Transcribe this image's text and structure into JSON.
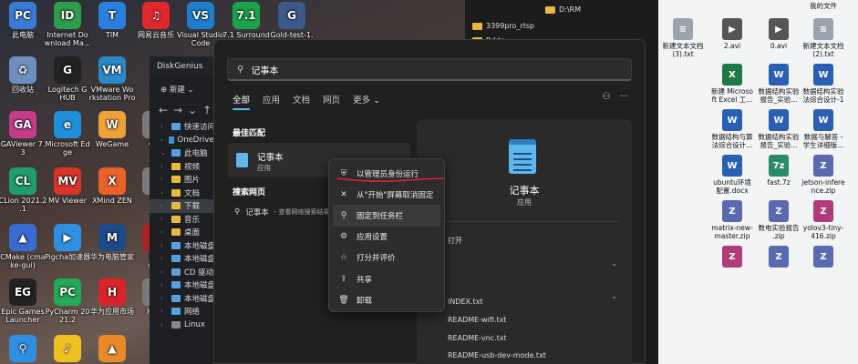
{
  "desktop_left": [
    {
      "label": "此电脑",
      "color": "#3a7bd5",
      "glyph": "PC"
    },
    {
      "label": "Internet Do\nwnload Ma...",
      "color": "#2e9d4a",
      "glyph": "ID"
    },
    {
      "label": "TIM",
      "color": "#2b7fe0",
      "glyph": "T"
    },
    {
      "label": "网易云音乐",
      "color": "#e0282e",
      "glyph": "♫"
    },
    {
      "label": "Visual Studio\nCode",
      "color": "#1f7fcf",
      "glyph": "VS"
    },
    {
      "label": "7.1 Surround",
      "color": "#1aa34a",
      "glyph": "7.1"
    },
    {
      "label": "Gold-test-1.",
      "color": "#3b5a8a",
      "glyph": "G"
    },
    {
      "label": "回收站",
      "color": "#6d8fbf",
      "glyph": "♻"
    },
    {
      "label": "Logitech G\nHUB",
      "color": "#222222",
      "glyph": "G"
    },
    {
      "label": "VMware Wo\nrkstation Pro",
      "color": "#2a8ac8",
      "glyph": "VM"
    },
    {
      "label": "GAViewer 7.\n3",
      "color": "#c43c8a",
      "glyph": "GA"
    },
    {
      "label": "Microsoft Ed\nge",
      "color": "#1e8fd8",
      "glyph": "e"
    },
    {
      "label": "WeGame",
      "color": "#f0a23a",
      "glyph": "W"
    },
    {
      "label": "Ope",
      "color": "#7a7a7a",
      "glyph": "O"
    },
    {
      "label": "CLion 2021.2\n.1",
      "color": "#1f9d6a",
      "glyph": "CL"
    },
    {
      "label": "MV Viewer",
      "color": "#d8342a",
      "glyph": "MV"
    },
    {
      "label": "XMind ZEN",
      "color": "#e8622a",
      "glyph": "X"
    },
    {
      "label": "Pic",
      "color": "#7a7a7a",
      "glyph": "P"
    },
    {
      "label": "CMake (cma\nke-gui)",
      "color": "#3a6bd0",
      "glyph": "▲"
    },
    {
      "label": "Pigcha加速器",
      "color": "#2f8fe0",
      "glyph": "▶"
    },
    {
      "label": "华为电脑管家",
      "color": "#1f4a8a",
      "glyph": "M"
    },
    {
      "label": "Red\ndem",
      "color": "#aa2222",
      "glyph": "R"
    },
    {
      "label": "Epic Games\nLauncher",
      "color": "#222222",
      "glyph": "EG"
    },
    {
      "label": "PyCharm 20\n21.2",
      "color": "#22aa55",
      "glyph": "PC"
    },
    {
      "label": "华为应用市场",
      "color": "#d8242a",
      "glyph": "H"
    },
    {
      "label": "HBUI",
      "color": "#7a7a7a",
      "glyph": "H"
    },
    {
      "label": "",
      "color": "#2f8fe0",
      "glyph": "⚲"
    },
    {
      "label": "",
      "color": "#f0c020",
      "glyph": "♪"
    },
    {
      "label": "",
      "color": "#e88a2a",
      "glyph": "▲"
    }
  ],
  "desktop_right": [
    {
      "label": "我的文件",
      "color": "#e8b93c",
      "glyph": ""
    },
    {
      "label": "新建文本文档\n(3).txt",
      "color": "#9aa4b0",
      "glyph": "≡"
    },
    {
      "label": "2.avi",
      "color": "#555555",
      "glyph": "▶"
    },
    {
      "label": "0.avi",
      "color": "#555555",
      "glyph": "▶"
    },
    {
      "label": "新建文本文档\n(2).txt",
      "color": "#9aa4b0",
      "glyph": "≡"
    },
    {
      "label": "新建 Microso\nft Excel 工...",
      "color": "#1d7a43",
      "glyph": "X"
    },
    {
      "label": "数据结构实验\n报告_实验...",
      "color": "#2b5fb3",
      "glyph": "W"
    },
    {
      "label": "数据结构实验\n法综合设计-1",
      "color": "#2b5fb3",
      "glyph": "W"
    },
    {
      "label": "数据结构与算\n法综合设计...",
      "color": "#2b5fb3",
      "glyph": "W"
    },
    {
      "label": "数据结构实验\n报告_实验...",
      "color": "#2b5fb3",
      "glyph": "W"
    },
    {
      "label": "数据与解答 -\n学生详细版...",
      "color": "#2b5fb3",
      "glyph": "W"
    },
    {
      "label": "ubuntu环境\n配置.docx",
      "color": "#2b5fb3",
      "glyph": "W"
    },
    {
      "label": "fast.7z",
      "color": "#2a8a6a",
      "glyph": "7z"
    },
    {
      "label": "jetson-infere\nnce.zip",
      "color": "#5a6ab0",
      "glyph": "Z"
    },
    {
      "label": "matrix-new-\nmaster.zip",
      "color": "#5a6ab0",
      "glyph": "Z"
    },
    {
      "label": "数电实验报告\n.zip",
      "color": "#5a6ab0",
      "glyph": "Z"
    },
    {
      "label": "yolov3-tiny-\n416.zip",
      "color": "#b03a7a",
      "glyph": "Z"
    },
    {
      "label": "",
      "color": "#b03a7a",
      "glyph": "Z"
    },
    {
      "label": "",
      "color": "#5a6ab0",
      "glyph": "Z"
    },
    {
      "label": "",
      "color": "#5a6ab0",
      "glyph": "Z"
    }
  ],
  "diskgenius": {
    "title": "DiskGenius",
    "new_label": "新建",
    "tree": [
      {
        "label": "快速访问",
        "chev": "›",
        "icon": "star"
      },
      {
        "label": "OneDrive - Pe",
        "chev": "›",
        "icon": "cloud"
      },
      {
        "label": "此电脑",
        "chev": "⌄",
        "icon": "pc"
      },
      {
        "label": "视频",
        "chev": "›",
        "icon": "folder"
      },
      {
        "label": "图片",
        "chev": "›",
        "icon": "folder"
      },
      {
        "label": "文档",
        "chev": "›",
        "icon": "folder"
      },
      {
        "label": "下载",
        "chev": "›",
        "icon": "folder"
      },
      {
        "label": "音乐",
        "chev": "›",
        "icon": "folder"
      },
      {
        "label": "桌面",
        "chev": "›",
        "icon": "folder"
      },
      {
        "label": "本地磁盘 (C",
        "chev": "›",
        "icon": "drive"
      },
      {
        "label": "本地磁盘 (D",
        "chev": "›",
        "icon": "drive"
      },
      {
        "label": "CD 驱动器",
        "chev": "›",
        "icon": "drive"
      },
      {
        "label": "本地磁盘 (F",
        "chev": "›",
        "icon": "drive"
      },
      {
        "label": "本地磁盘 (G",
        "chev": "›",
        "icon": "drive"
      },
      {
        "label": "网络",
        "chev": "›",
        "icon": "net"
      },
      {
        "label": "Linux",
        "chev": "›",
        "icon": "linux"
      }
    ]
  },
  "explorer": {
    "path": "D:\\RM",
    "rows": [
      "3399pro_rtsp",
      "Rdds"
    ]
  },
  "search": {
    "query": "记事本",
    "tabs": [
      "全部",
      "应用",
      "文档",
      "网页",
      "更多"
    ],
    "best_match_heading": "最佳匹配",
    "best_match": {
      "name": "记事本",
      "type": "应用"
    },
    "web_heading": "搜索网页",
    "web_query": "记事本",
    "web_sub": "- 查看网络搜索结果",
    "detail": {
      "name": "记事本",
      "type": "应用",
      "open": "打开",
      "recent": [
        "INDEX.txt",
        "README-wifi.txt",
        "README-vnc.txt",
        "README-usb-dev-mode.txt"
      ]
    }
  },
  "context_menu": [
    {
      "label": "以管理员身份运行",
      "icon": "shield-icon",
      "glyph": "⛨"
    },
    {
      "label": "从\"开始\"屏幕取消固定",
      "icon": "unpin-icon",
      "glyph": "✕"
    },
    {
      "label": "固定到任务栏",
      "icon": "pin-icon",
      "glyph": "⚲"
    },
    {
      "label": "应用设置",
      "icon": "gear-icon",
      "glyph": "⚙"
    },
    {
      "label": "打分并评价",
      "icon": "star-icon",
      "glyph": "☆"
    },
    {
      "label": "共享",
      "icon": "share-icon",
      "glyph": "⇪"
    },
    {
      "label": "卸载",
      "icon": "trash-icon",
      "glyph": "🗑"
    }
  ]
}
